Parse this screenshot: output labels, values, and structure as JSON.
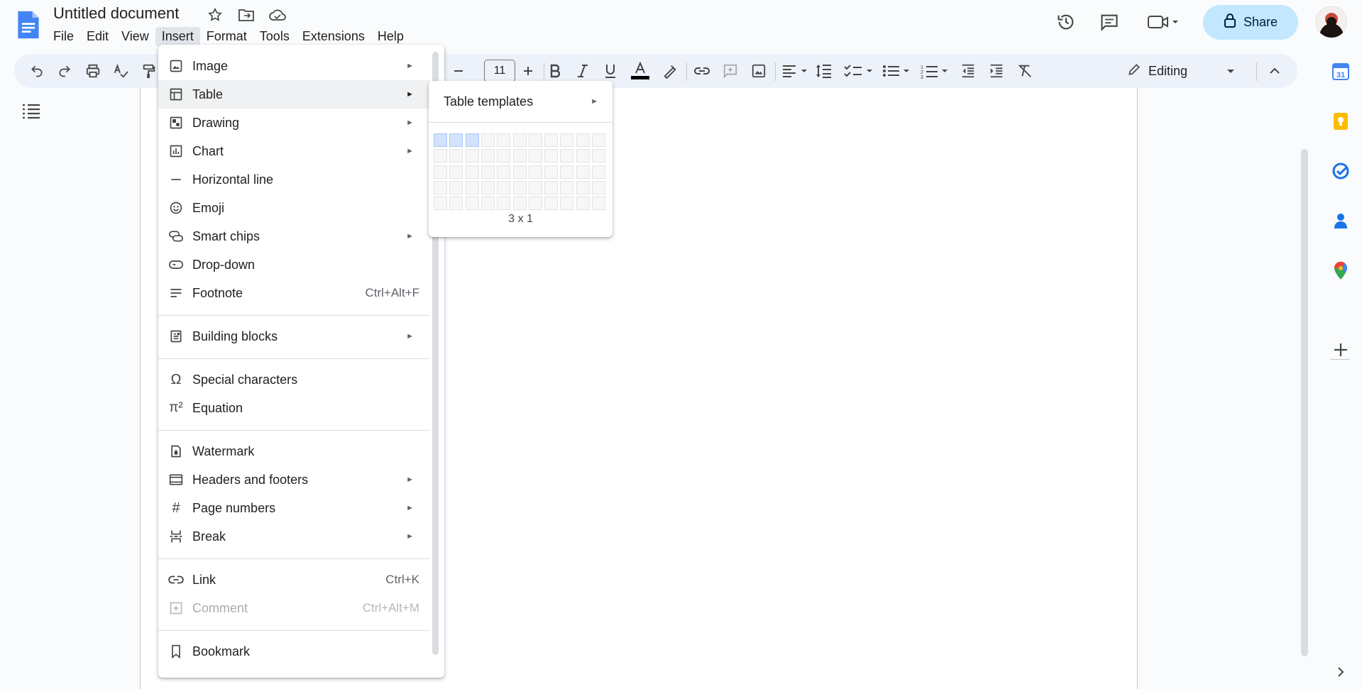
{
  "doc": {
    "title": "Untitled document"
  },
  "menubar": [
    "File",
    "Edit",
    "View",
    "Insert",
    "Format",
    "Tools",
    "Extensions",
    "Help"
  ],
  "header": {
    "share_label": "Share"
  },
  "toolbar": {
    "font_size": "11",
    "mode_label": "Editing"
  },
  "insert_menu": {
    "items": [
      {
        "label": "Image",
        "icon": "image-icon",
        "arrow": true
      },
      {
        "label": "Table",
        "icon": "table-icon",
        "arrow": true
      },
      {
        "label": "Drawing",
        "icon": "drawing-icon",
        "arrow": true
      },
      {
        "label": "Chart",
        "icon": "chart-icon",
        "arrow": true
      },
      {
        "label": "Horizontal line",
        "icon": "horizontal-line-icon"
      },
      {
        "label": "Emoji",
        "icon": "emoji-icon"
      },
      {
        "label": "Smart chips",
        "icon": "smart-chips-icon",
        "arrow": true
      },
      {
        "label": "Drop-down",
        "icon": "dropdown-chip-icon"
      },
      {
        "label": "Footnote",
        "icon": "footnote-icon",
        "shortcut": "Ctrl+Alt+F"
      },
      {
        "label": "Building blocks",
        "icon": "building-blocks-icon",
        "arrow": true
      },
      {
        "label": "Special characters",
        "icon": "omega-icon"
      },
      {
        "label": "Equation",
        "icon": "pi-icon"
      },
      {
        "label": "Watermark",
        "icon": "watermark-icon"
      },
      {
        "label": "Headers and footers",
        "icon": "headers-footers-icon",
        "arrow": true
      },
      {
        "label": "Page numbers",
        "icon": "hash-icon",
        "arrow": true
      },
      {
        "label": "Break",
        "icon": "break-icon",
        "arrow": true
      },
      {
        "label": "Link",
        "icon": "link-icon",
        "shortcut": "Ctrl+K"
      },
      {
        "label": "Comment",
        "icon": "add-comment-icon",
        "shortcut": "Ctrl+Alt+M",
        "disabled": true
      },
      {
        "label": "Bookmark",
        "icon": "bookmark-icon"
      }
    ]
  },
  "table_submenu": {
    "templates_label": "Table templates",
    "grid_label": "3 x 1",
    "grid_columns": 11,
    "grid_rows": 5,
    "selected_columns": 3,
    "selected_rows": 1
  },
  "colors": {
    "share_bg": "#c2e7ff",
    "toolbar_bg": "#edf2fa",
    "doc_blue": "#4285f4",
    "hover": "#eff1f3",
    "grid_selected": "#d3e3fd"
  }
}
